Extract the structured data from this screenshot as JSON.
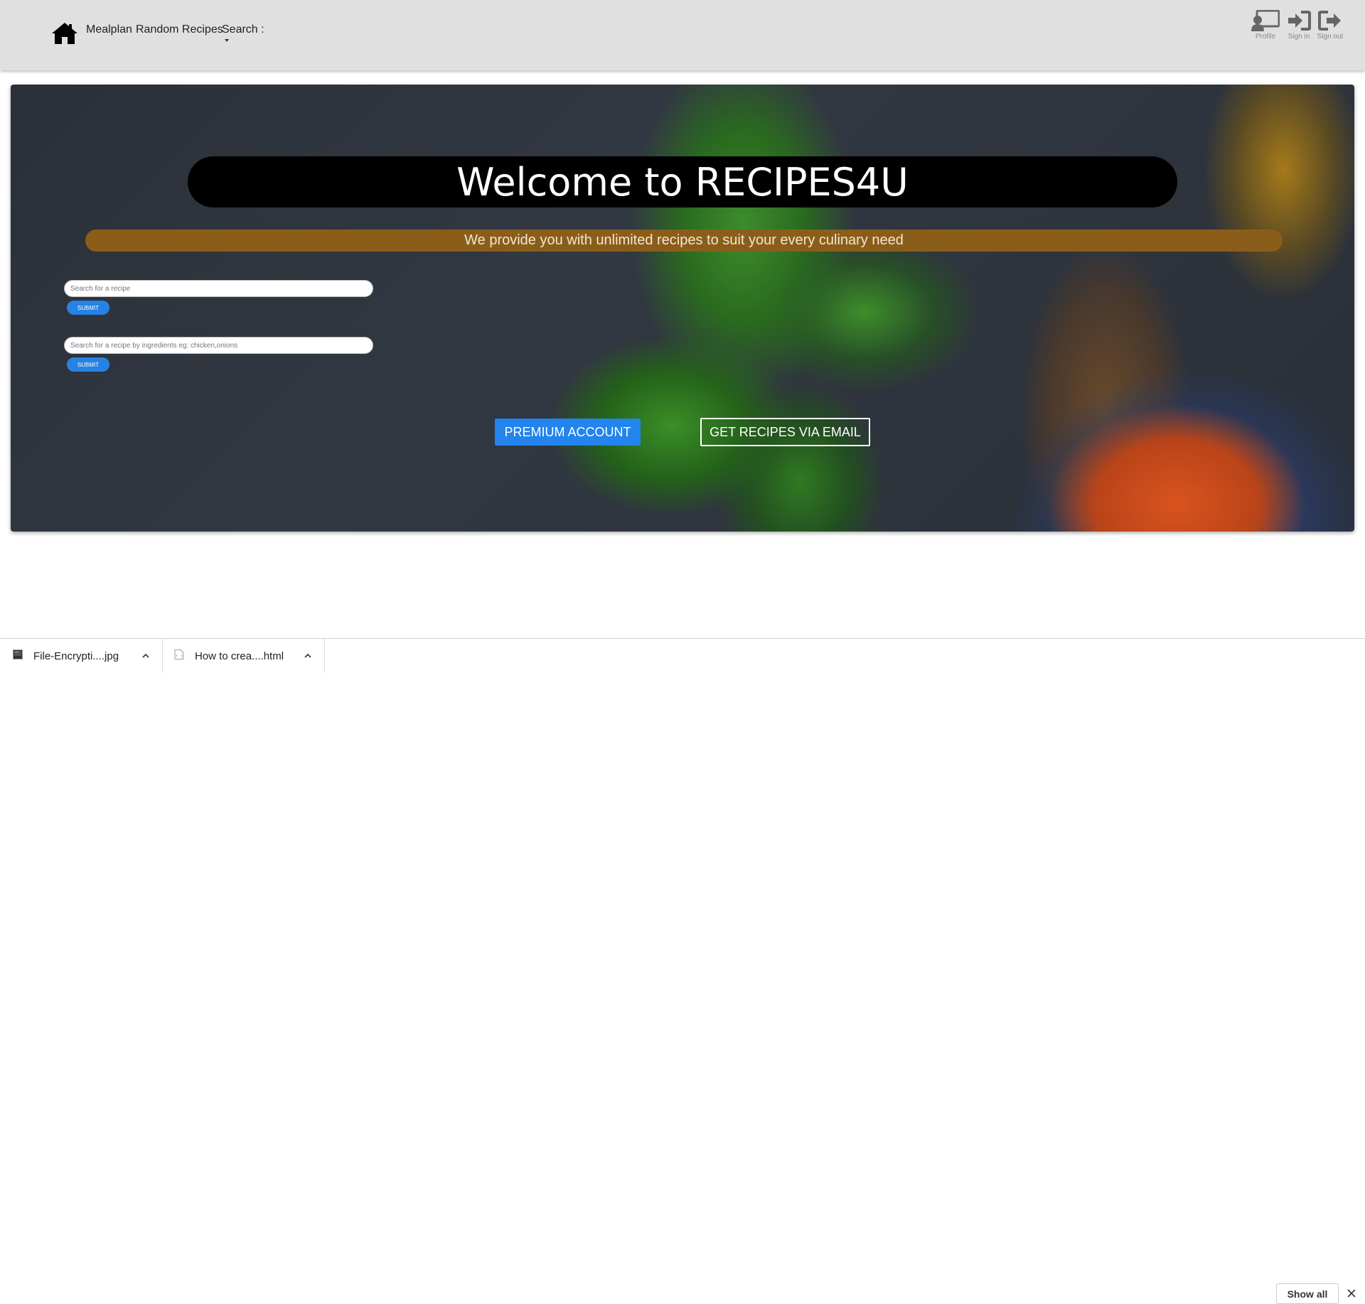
{
  "navbar": {
    "home_icon": "home-icon",
    "links": {
      "mealplan": "Mealplan",
      "random": "Random Recipes",
      "search": "Search :"
    },
    "user_actions": {
      "profile": "Profile",
      "sign_in": "Sign in",
      "sign_out": "Sign out"
    }
  },
  "hero": {
    "title": "Welcome to RECIPES4U",
    "subtitle": "We provide you with unlimited recipes to suit your every culinary need",
    "search_recipe": {
      "placeholder": "Search for a recipe",
      "value": "",
      "submit_label": "SUBMIT"
    },
    "search_ingredients": {
      "placeholder": "Search for a recipe by ingredients eg: chicken,onions",
      "value": "",
      "submit_label": "SUBMIT"
    },
    "premium_label": "PREMIUM ACCOUNT",
    "email_label": "GET RECIPES VIA EMAIL"
  },
  "downloads": {
    "items": [
      {
        "name": "File-Encrypti....jpg",
        "icon": "image-file-icon"
      },
      {
        "name": "How to crea....html",
        "icon": "html-file-icon"
      }
    ],
    "show_all_label": "Show all"
  },
  "colors": {
    "navbar_bg": "#e0e0e0",
    "title_bar": "#000000",
    "subtitle_bar": "#8a5e1a",
    "primary_blue": "#2284ec"
  }
}
